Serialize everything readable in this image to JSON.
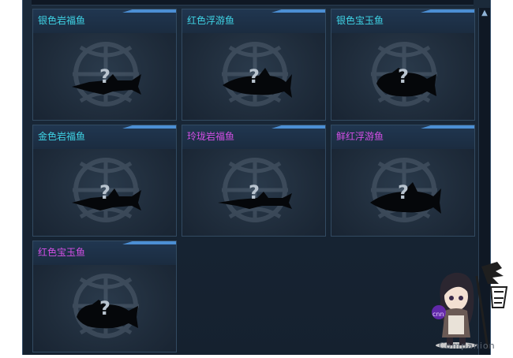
{
  "fish_cards": [
    {
      "name": "银色岩福鱼",
      "name_color": "#3fd4e6",
      "unknown_mark": "?"
    },
    {
      "name": "红色浮游鱼",
      "name_color": "#3fd4e6",
      "unknown_mark": "?"
    },
    {
      "name": "银色宝玉鱼",
      "name_color": "#3fd4e6",
      "unknown_mark": "?"
    },
    {
      "name": "金色岩福鱼",
      "name_color": "#3fd4e6",
      "unknown_mark": "?"
    },
    {
      "name": "玲珑岩福鱼",
      "name_color": "#d34fe6",
      "unknown_mark": "?"
    },
    {
      "name": "鲜红浮游鱼",
      "name_color": "#d34fe6",
      "unknown_mark": "?"
    },
    {
      "name": "红色宝玉鱼",
      "name_color": "#d34fe6",
      "unknown_mark": "?"
    }
  ],
  "watermark": {
    "caption": "Companion",
    "badge": "cnn"
  },
  "icons": {
    "scroll_up": "scroll-up-arrow-icon",
    "fish_silhouette": "fish-silhouette-icon",
    "mascot": "mascot-character-icon"
  },
  "colors": {
    "panel_bg": "#172433",
    "title_common": "#3fd4e6",
    "title_rare": "#d34fe6",
    "card_border": "#324a61"
  }
}
